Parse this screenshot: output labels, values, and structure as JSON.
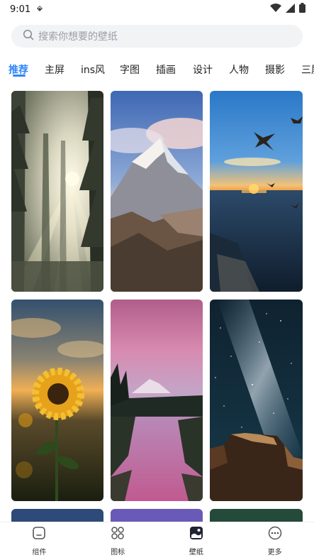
{
  "status": {
    "time": "9:01"
  },
  "search": {
    "placeholder": "搜索你想要的壁纸"
  },
  "tabs": [
    {
      "label": "推荐"
    },
    {
      "label": "主屏"
    },
    {
      "label": "ins风"
    },
    {
      "label": "字图"
    },
    {
      "label": "插画"
    },
    {
      "label": "设计"
    },
    {
      "label": "人物"
    },
    {
      "label": "摄影"
    },
    {
      "label": "三屏"
    }
  ],
  "active_tab": "推荐",
  "wallpapers": [
    {
      "subject": "sunlit forest"
    },
    {
      "subject": "snowy mountain peak"
    },
    {
      "subject": "sunset over sea with seagulls"
    },
    {
      "subject": "sunflower at dusk"
    },
    {
      "subject": "pink sky mountain reflection"
    },
    {
      "subject": "milky way night sky"
    }
  ],
  "bottom_nav": [
    {
      "label": "组件"
    },
    {
      "label": "图标"
    },
    {
      "label": "壁纸"
    },
    {
      "label": "更多"
    }
  ],
  "active_nav": "壁纸",
  "colors": {
    "accent": "#2f86f6"
  }
}
